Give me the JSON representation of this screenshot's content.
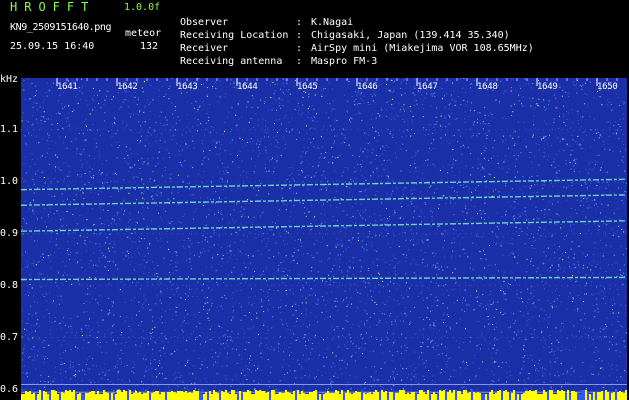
{
  "app": {
    "title": "HROFFT",
    "version": "1.0.0f"
  },
  "file": {
    "name": "KN9_2509151640.png",
    "timestamp": "25.09.15 16:40"
  },
  "counter": {
    "label": "meteor",
    "value": "132"
  },
  "meta": [
    {
      "key": "Observer",
      "value": "K.Nagai"
    },
    {
      "key": "Receiving Location",
      "value": "Chigasaki, Japan (139.414 35.340)"
    },
    {
      "key": "Receiver",
      "value": "AirSpy mini (Miakejima VOR 108.65MHz)"
    },
    {
      "key": "Receiving antenna",
      "value": "Maspro FM-3"
    }
  ],
  "colors": {
    "title": "#88ff44",
    "text": "#ffffff",
    "background": "#000000",
    "waterfall": "#1a2fa8",
    "bottom_band": "#ffff00"
  },
  "axis": {
    "unit": "kHz",
    "y_ticks": [
      "1.1",
      "1.0",
      "0.9",
      "0.8",
      "0.7",
      "0.6"
    ],
    "x_ticks": [
      "1641",
      "1642",
      "1643",
      "1644",
      "1645",
      "1646",
      "1647",
      "1648",
      "1649",
      "1650"
    ]
  },
  "chart_data": {
    "type": "heatmap",
    "xlabel": "",
    "ylabel": "kHz",
    "x": [
      1641,
      1642,
      1643,
      1644,
      1645,
      1646,
      1647,
      1648,
      1649,
      1650
    ],
    "ylim": [
      0.58,
      1.2
    ],
    "traces": [
      {
        "freq_start": 0.985,
        "freq_end": 1.005
      },
      {
        "freq_start": 0.955,
        "freq_end": 0.975
      },
      {
        "freq_start": 0.905,
        "freq_end": 0.925
      },
      {
        "freq_start": 0.812,
        "freq_end": 0.816
      }
    ]
  }
}
